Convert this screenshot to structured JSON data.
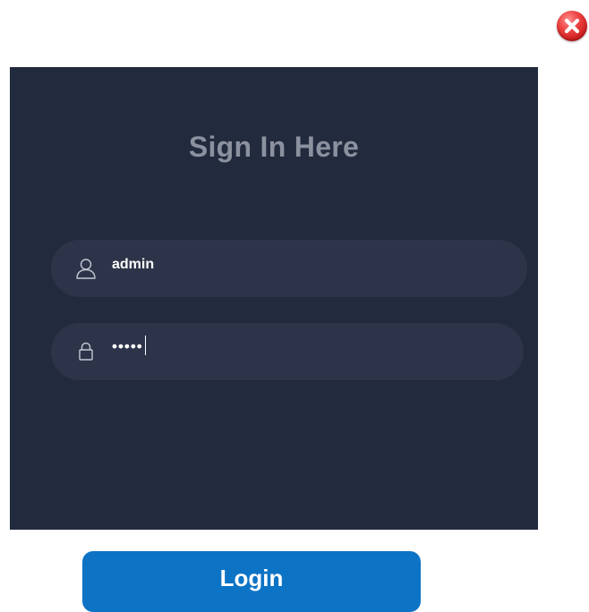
{
  "dialog": {
    "close_icon": "close-icon",
    "close_color": "#e8322f"
  },
  "form": {
    "title": "Sign In Here",
    "username": {
      "icon": "user-icon",
      "value": "admin"
    },
    "password": {
      "icon": "lock-icon",
      "value": "•••••"
    },
    "panel_color": "#222a3e",
    "field_color": "#2d3449"
  },
  "actions": {
    "login_label": "Login",
    "login_color": "#0d73c5"
  }
}
